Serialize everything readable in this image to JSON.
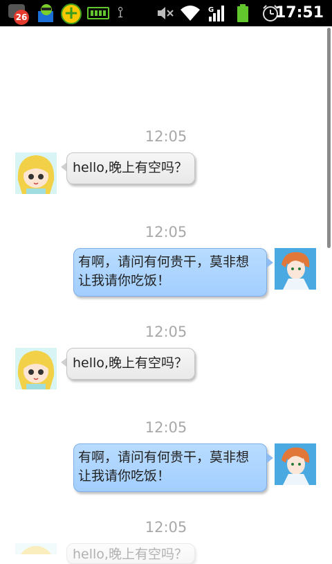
{
  "status_bar": {
    "notification_count": "26",
    "time": "17:51",
    "icons": [
      "notification-icon",
      "android-app-icon",
      "plus-app-icon",
      "battery-app-icon",
      "usb-icon",
      "mute-icon",
      "wifi-icon",
      "signal-icon",
      "battery-icon",
      "alarm-icon"
    ]
  },
  "colors": {
    "incoming_bubble": "#ececec",
    "outgoing_bubble": "#aed4ff",
    "timestamp": "#a8a8a8"
  },
  "messages": [
    {
      "time": "12:05",
      "direction": "incoming",
      "text": "hello,晚上有空吗？",
      "avatar": "girl-avatar"
    },
    {
      "time": "12:05",
      "direction": "outgoing",
      "text_line1": "有啊，请问有何贵干，莫非想",
      "text_line2": "让我请你吃饭！",
      "avatar": "boy-avatar"
    },
    {
      "time": "12:05",
      "direction": "incoming",
      "text": "hello,晚上有空吗？",
      "avatar": "girl-avatar"
    },
    {
      "time": "12:05",
      "direction": "outgoing",
      "text_line1": "有啊，请问有何贵干，莫非想",
      "text_line2": "让我请你吃饭！",
      "avatar": "boy-avatar"
    },
    {
      "time": "12:05",
      "direction": "incoming",
      "text": "hello,晚上有空吗？",
      "avatar": "girl-avatar"
    }
  ]
}
